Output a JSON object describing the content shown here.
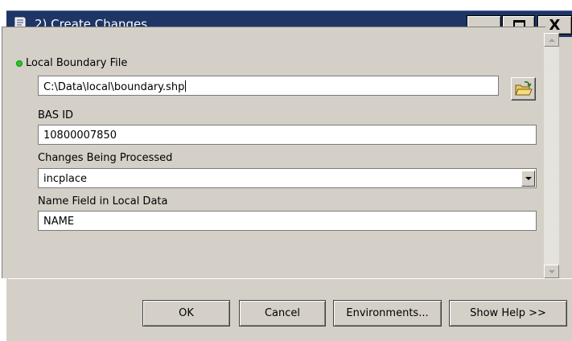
{
  "window": {
    "title": "2) Create Changes",
    "minimize_label": "_",
    "close_label": "X"
  },
  "form": {
    "local_boundary": {
      "label": "Local Boundary File",
      "value": "C:\\Data\\local\\boundary.shp"
    },
    "bas_id": {
      "label": "BAS ID",
      "value": "10800007850"
    },
    "changes": {
      "label": "Changes Being Processed",
      "value": "incplace"
    },
    "name_field": {
      "label": "Name Field in Local Data",
      "value": "NAME"
    }
  },
  "buttons": {
    "ok": "OK",
    "cancel": "Cancel",
    "environments": "Environments...",
    "show_help": "Show Help >>"
  },
  "icons": {
    "app": "toolbox-scroll-icon",
    "browse": "open-folder-icon",
    "required": "green-dot-icon"
  },
  "colors": {
    "titlebar": "#1e3566",
    "dialog_bg": "#d4d0c8",
    "required_dot": "#22cc22"
  }
}
